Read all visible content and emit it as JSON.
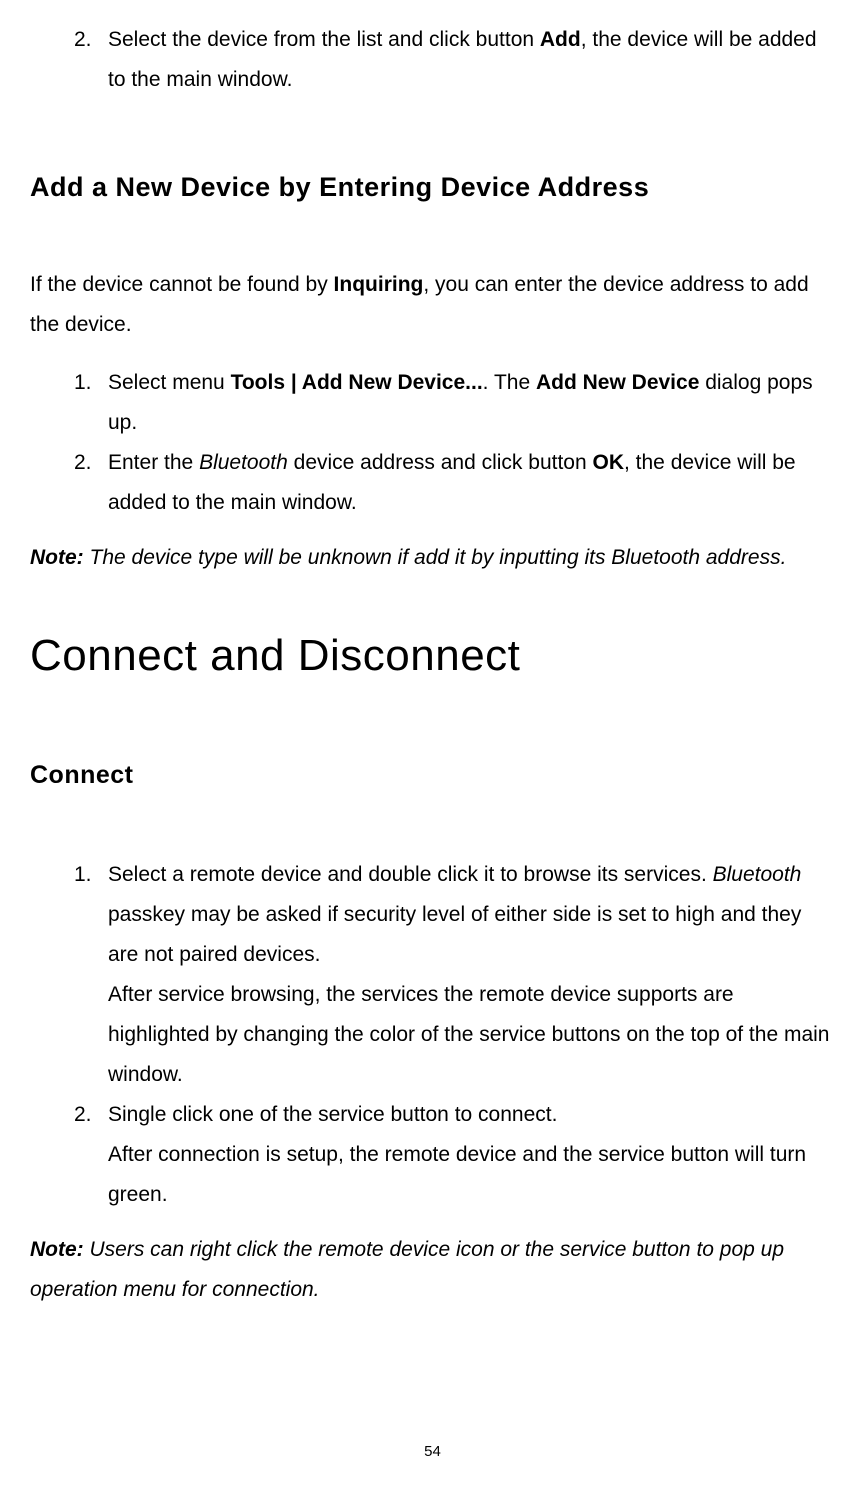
{
  "topList": {
    "item2": {
      "number": "2.",
      "text_prefix": "Select the device from the list and click button ",
      "text_bold": "Add",
      "text_suffix": ", the device will be added to the main window."
    }
  },
  "heading1": "Add a New Device by Entering Device Address",
  "paragraph1": {
    "prefix": "If the device cannot be found by ",
    "bold": "Inquiring",
    "suffix": ", you can enter the device address to add the device."
  },
  "list2": {
    "item1": {
      "number": "1.",
      "prefix": "Select menu ",
      "bold1": "Tools | Add New Device...",
      "mid": ". The ",
      "bold2": "Add New Device",
      "suffix": " dialog pops up."
    },
    "item2": {
      "number": "2.",
      "prefix": "Enter the ",
      "italic": "Bluetooth",
      "mid": " device address and click button ",
      "bold": "OK",
      "suffix": ", the device will be added to the main window."
    }
  },
  "note1": {
    "label": "Note:",
    "text": " The device type will be unknown if add it by inputting its Bluetooth address."
  },
  "heading2": "Connect and Disconnect",
  "heading3": "Connect",
  "list3": {
    "item1": {
      "number": "1.",
      "line1_prefix": "Select a remote device and double click it to browse its services. ",
      "line1_italic": "Bluetooth",
      "line1_suffix": " passkey may be asked if security level of either side is set to high and they are not paired devices.",
      "line2": "After service browsing, the services the remote device supports are highlighted by changing the color of the service buttons on the top of the main window."
    },
    "item2": {
      "number": "2.",
      "line1": "Single click one of the service button to connect.",
      "line2": "After connection is setup, the remote device and the service button will turn green."
    }
  },
  "note2": {
    "label": "Note:",
    "text": " Users can right click the remote device icon or the service button to pop up operation menu for connection."
  },
  "pageNumber": "54"
}
